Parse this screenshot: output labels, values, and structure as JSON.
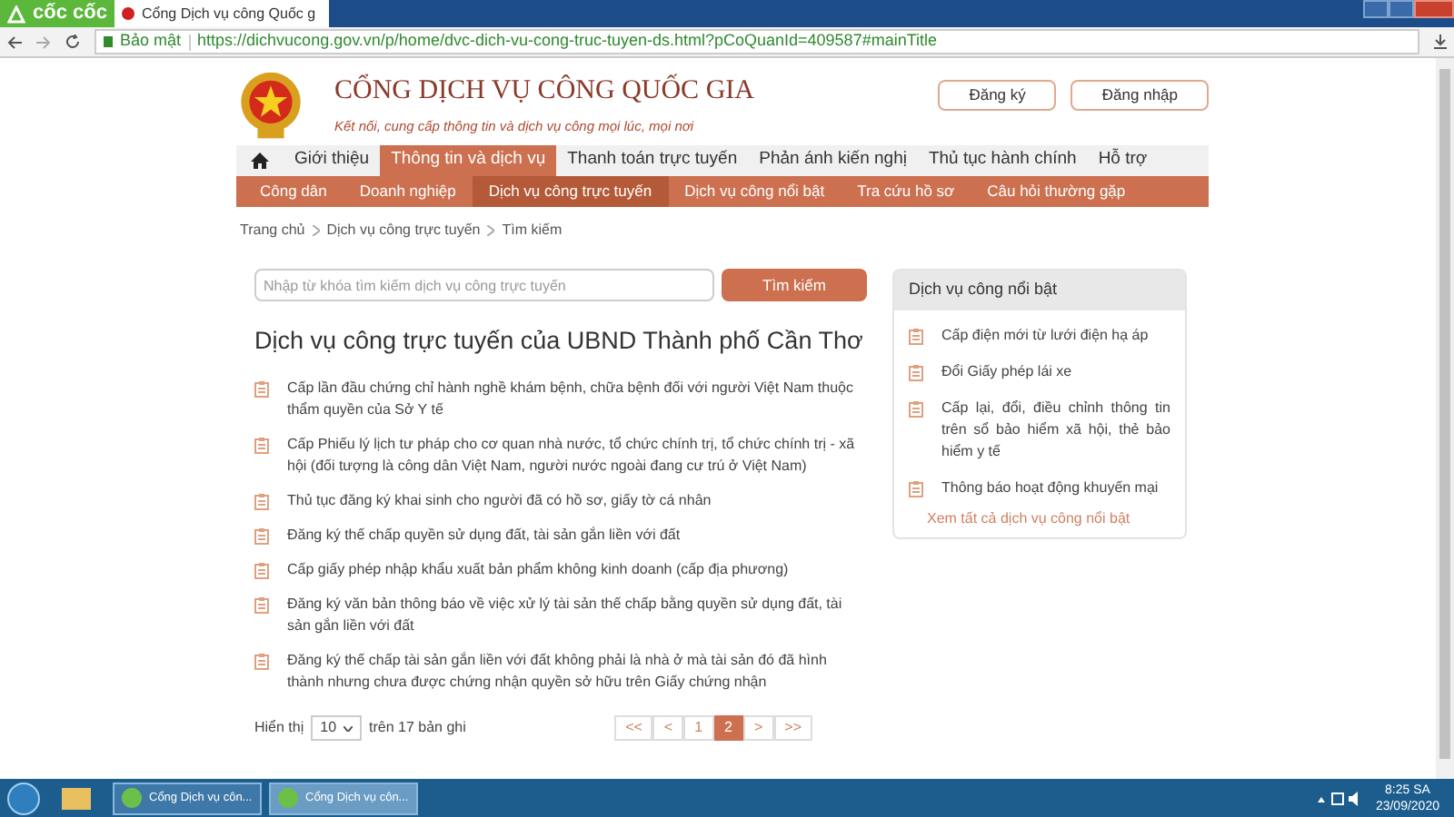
{
  "browser": {
    "brand": "cốc cốc",
    "tab_title": "Cổng Dịch vụ công Quốc g",
    "security": "Bảo mật",
    "url": "https://dichvucong.gov.vn/p/home/dvc-dich-vu-cong-truc-tuyen-ds.html?pCoQuanId=409587#mainTitle"
  },
  "header": {
    "title": "CỔNG DỊCH VỤ CÔNG QUỐC GIA",
    "subtitle": "Kết nối, cung cấp thông tin và dịch vụ công mọi lúc, mọi nơi",
    "buttons": [
      "Đăng ký",
      "Đăng nhập"
    ]
  },
  "main_nav": [
    {
      "label": "Giới thiệu",
      "selected": false
    },
    {
      "label": "Thông tin và dịch vụ",
      "selected": true
    },
    {
      "label": "Thanh toán trực tuyến",
      "selected": false
    },
    {
      "label": "Phản ánh kiến nghị",
      "selected": false
    },
    {
      "label": "Thủ tục hành chính",
      "selected": false
    },
    {
      "label": "Hỗ trợ",
      "selected": false
    }
  ],
  "sub_nav": [
    {
      "label": "Công dân",
      "selected": false
    },
    {
      "label": "Doanh nghiệp",
      "selected": false
    },
    {
      "label": "Dịch vụ công trực tuyến",
      "selected": true
    },
    {
      "label": "Dịch vụ công nổi bật",
      "selected": false
    },
    {
      "label": "Tra cứu hồ sơ",
      "selected": false
    },
    {
      "label": "Câu hỏi thường gặp",
      "selected": false
    }
  ],
  "breadcrumb": [
    "Trang chủ",
    "Dịch vụ công trực tuyến",
    "Tìm kiếm"
  ],
  "search": {
    "placeholder": "Nhập từ khóa tìm kiếm dịch vụ công trực tuyến",
    "button": "Tìm kiếm"
  },
  "heading": "Dịch vụ công trực tuyến của UBND Thành phố Cần Thơ",
  "services": [
    "Cấp lần đầu chứng chỉ hành nghề khám bệnh, chữa bệnh đối với người Việt Nam thuộc thẩm quyền của Sở Y tế",
    "Cấp Phiếu lý lịch tư pháp cho cơ quan nhà nước, tổ chức chính trị, tổ chức chính trị - xã hội (đối tượng là công dân Việt Nam, người nước ngoài đang cư trú ở Việt Nam)",
    "Thủ tục đăng ký khai sinh cho người đã có hồ sơ, giấy tờ cá nhân",
    "Đăng ký thế chấp quyền sử dụng đất, tài sản gắn liền với đất",
    "Cấp giấy phép nhập khẩu xuất bản phẩm không kinh doanh (cấp địa phương)",
    "Đăng ký văn bản thông báo về việc xử lý tài sản thế chấp bằng quyền sử dụng đất, tài sản gắn liền với đất",
    "Đăng ký thế chấp tài sản gắn liền với đất không phải là nhà ở mà tài sản đó đã hình thành nhưng chưa được chứng nhận quyền sở hữu trên Giấy chứng nhận"
  ],
  "pagination": {
    "show_label": "Hiển thị",
    "page_size": "10",
    "total": "trên 17 bản ghi",
    "pages": [
      {
        "label": "<<",
        "selected": false
      },
      {
        "label": "<",
        "selected": false
      },
      {
        "label": "1",
        "selected": false
      },
      {
        "label": "2",
        "selected": true
      },
      {
        "label": ">",
        "selected": false
      },
      {
        "label": ">>",
        "selected": false
      }
    ]
  },
  "sidebar": {
    "title": "Dịch vụ công nổi bật",
    "items": [
      "Cấp điện mới từ lưới điện hạ áp",
      "Đổi Giấy phép lái xe",
      "Cấp lại, đổi, điều chỉnh thông tin trên sổ bảo hiểm xã hội, thẻ bảo hiểm y tế",
      "Thông báo hoạt động khuyến mại"
    ],
    "link": "Xem tất cả dịch vụ công nổi bật"
  },
  "taskbar": {
    "windows": [
      {
        "label": "Cổng Dịch vụ côn...",
        "selected": false
      },
      {
        "label": "Cổng Dịch vụ côn...",
        "selected": true
      }
    ],
    "time": "8:25 SA",
    "date": "23/09/2020"
  }
}
